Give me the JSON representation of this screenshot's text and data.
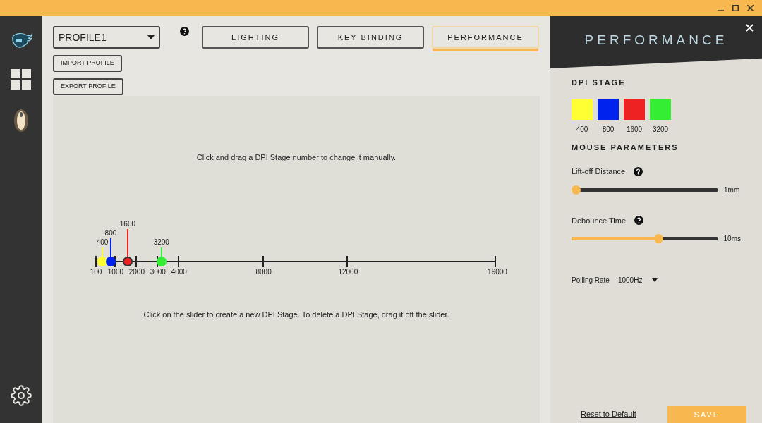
{
  "profile_select": {
    "value": "PROFILE1"
  },
  "tabs": [
    {
      "label": "LIGHTING",
      "selected": false
    },
    {
      "label": "KEY BINDING",
      "selected": false
    },
    {
      "label": "PERFORMANCE",
      "selected": true
    }
  ],
  "profile_buttons": [
    "IMPORT PROFILE",
    "EXPORT PROFILE"
  ],
  "dpi_editor": {
    "hint_top": "Click and drag a DPI Stage number to change it manually.",
    "ticks": [
      {
        "label": "100",
        "level": 0
      },
      {
        "label": "1000",
        "level": 0.0476
      },
      {
        "label": "2000",
        "level": 0.1005
      },
      {
        "label": "3000",
        "level": 0.1534
      },
      {
        "label": "4000",
        "level": 0.2063
      },
      {
        "label": "8000",
        "level": 0.418
      },
      {
        "label": "12000",
        "level": 0.6296
      },
      {
        "label": "19000",
        "level": 1
      }
    ],
    "stages": [
      {
        "label": "400",
        "level": 0.0159,
        "color": "#ffff33",
        "selected": false
      },
      {
        "label": "800",
        "level": 0.037,
        "color": "#0022ee",
        "selected": false
      },
      {
        "label": "1600",
        "level": 0.0794,
        "color": "#ee2222",
        "selected": true
      },
      {
        "label": "3200",
        "level": 0.164,
        "color": "#33ee33",
        "selected": false
      }
    ],
    "hint_bottom": "Click on the slider to create a new DPI Stage. To delete a DPI Stage, drag it off the slider."
  },
  "panel": {
    "title": "PERFORMANCE",
    "dpi_stage": {
      "heading": "DPI STAGE",
      "swatches": [
        {
          "label": "400",
          "color": "#ffff33"
        },
        {
          "label": "800",
          "color": "#0022ee"
        },
        {
          "label": "1600",
          "color": "#ee2222"
        },
        {
          "label": "3200",
          "color": "#33ee33"
        }
      ]
    },
    "mouse_parameters": {
      "heading": "MOUSE PARAMETERS",
      "sliders": [
        {
          "label": "Lift-off Distance",
          "level": 0,
          "reading": "1mm"
        },
        {
          "label": "Debounce Time",
          "level": 0.6,
          "reading": "10ms"
        }
      ],
      "polling_rate": {
        "label": "Polling Rate",
        "value": "1000Hz"
      }
    },
    "reset_link": "Reset to Default",
    "save_button": "SAVE"
  }
}
